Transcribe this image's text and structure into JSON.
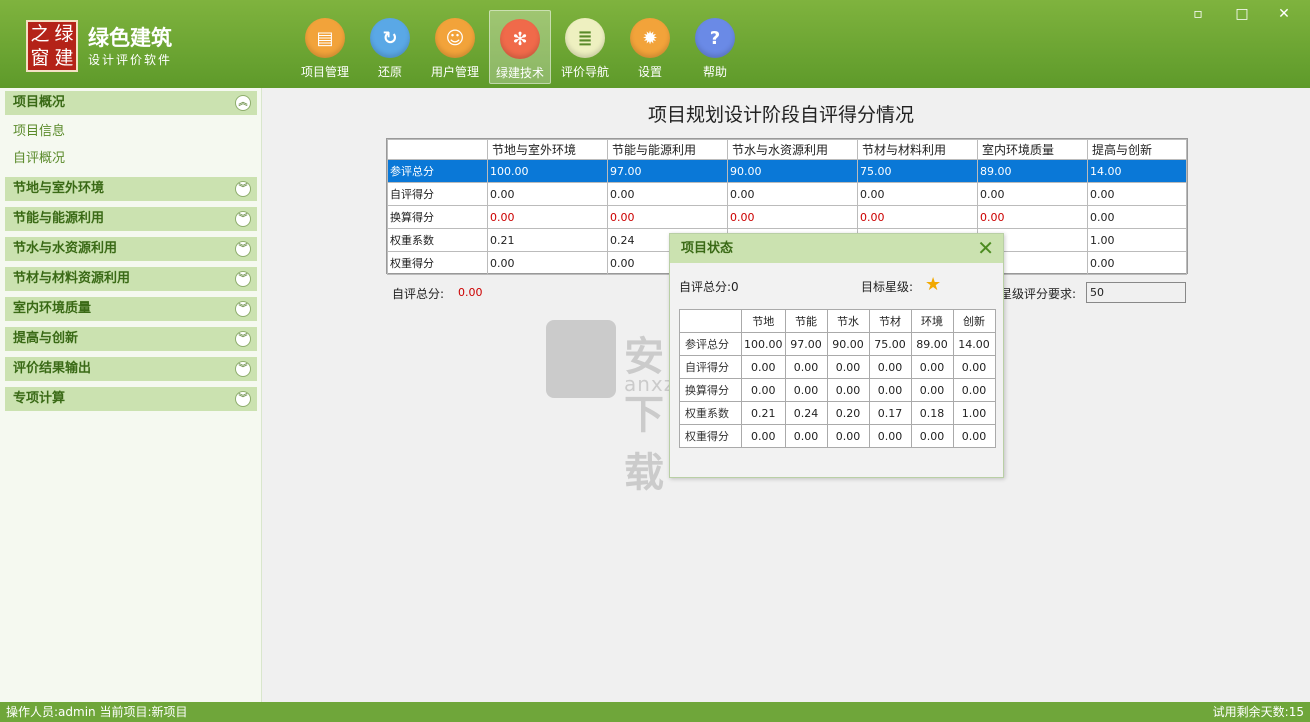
{
  "app": {
    "logo_chars": [
      "之",
      "绿",
      "窗",
      "建"
    ],
    "title": "绿色建筑",
    "subtitle": "设计评价软件"
  },
  "toolbar": [
    {
      "label": "项目管理",
      "icon": "folder-icon",
      "color": "#e8882a"
    },
    {
      "label": "还原",
      "icon": "refresh-icon",
      "color": "#3d8fd6"
    },
    {
      "label": "用户管理",
      "icon": "user-icon",
      "color": "#e8882a"
    },
    {
      "label": "绿建技术",
      "icon": "network-icon",
      "color": "#e04a2a"
    },
    {
      "label": "评价导航",
      "icon": "book-icon",
      "color": "#6a9a2a"
    },
    {
      "label": "设置",
      "icon": "gear-icon",
      "color": "#e8882a"
    },
    {
      "label": "帮助",
      "icon": "help-icon",
      "color": "#4a6ad6"
    }
  ],
  "window": {
    "minimize": "▫",
    "maximize": "□",
    "close": "✕"
  },
  "sidebar": {
    "groups": [
      "项目概况",
      "节地与室外环境",
      "节能与能源利用",
      "节水与水资源利用",
      "节材与材料资源利用",
      "室内环境质量",
      "提高与创新",
      "评价结果输出",
      "专项计算"
    ],
    "sub_items": [
      "项目信息",
      "自评概况"
    ]
  },
  "main": {
    "title": "项目规划设计阶段自评得分情况",
    "table": {
      "columns": [
        "",
        "节地与室外环境",
        "节能与能源利用",
        "节水与水资源利用",
        "节材与材料利用",
        "室内环境质量",
        "提高与创新"
      ],
      "rows": [
        {
          "label": "参评总分",
          "values": [
            "100.00",
            "97.00",
            "90.00",
            "75.00",
            "89.00",
            "14.00"
          ]
        },
        {
          "label": "自评得分",
          "values": [
            "0.00",
            "0.00",
            "0.00",
            "0.00",
            "0.00",
            "0.00"
          ]
        },
        {
          "label": "换算得分",
          "values": [
            "0.00",
            "0.00",
            "0.00",
            "0.00",
            "0.00",
            "0.00"
          ]
        },
        {
          "label": "权重系数",
          "values": [
            "0.21",
            "0.24",
            "",
            "",
            "",
            "1.00"
          ]
        },
        {
          "label": "权重得分",
          "values": [
            "0.00",
            "0.00",
            "",
            "",
            "",
            "0.00"
          ]
        }
      ]
    },
    "total_label": "自评总分:",
    "total_value": "0.00",
    "requirement_label": "星级评分要求:",
    "requirement_value": "50"
  },
  "dialog": {
    "title": "项目状态",
    "self_total_label": "自评总分:",
    "self_total_value": "0",
    "star_label": "目标星级:",
    "columns": [
      "",
      "节地",
      "节能",
      "节水",
      "节材",
      "环境",
      "创新"
    ],
    "rows": [
      {
        "label": "参评总分",
        "values": [
          "100.00",
          "97.00",
          "90.00",
          "75.00",
          "89.00",
          "14.00"
        ]
      },
      {
        "label": "自评得分",
        "values": [
          "0.00",
          "0.00",
          "0.00",
          "0.00",
          "0.00",
          "0.00"
        ]
      },
      {
        "label": "换算得分",
        "values": [
          "0.00",
          "0.00",
          "0.00",
          "0.00",
          "0.00",
          "0.00"
        ]
      },
      {
        "label": "权重系数",
        "values": [
          "0.21",
          "0.24",
          "0.20",
          "0.17",
          "0.18",
          "1.00"
        ]
      },
      {
        "label": "权重得分",
        "values": [
          "0.00",
          "0.00",
          "0.00",
          "0.00",
          "0.00",
          "0.00"
        ]
      }
    ]
  },
  "watermark": {
    "text": "安下载",
    "url": "anxz.com"
  },
  "status": {
    "left": "操作人员:admin  当前项目:新项目",
    "right": "试用剩余天数:15"
  }
}
